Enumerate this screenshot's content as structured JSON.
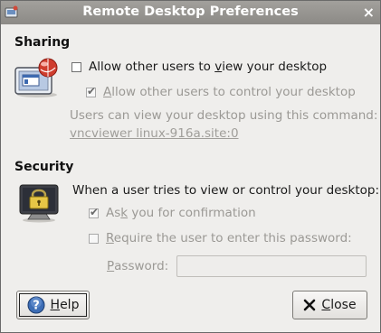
{
  "window": {
    "title": "Remote Desktop Preferences",
    "close_glyph": "×"
  },
  "sharing": {
    "heading": "Sharing",
    "icon": "remote-desktop-share-icon",
    "allow_view": {
      "pre": "Allow other users to ",
      "mnemonic": "v",
      "post": "iew your desktop",
      "checked": false
    },
    "allow_control": {
      "pre": "",
      "mnemonic": "A",
      "post": "llow other users to control your desktop",
      "checked": true,
      "enabled": false
    },
    "command_hint": "Users can view your desktop using this command:",
    "command_link": "vncviewer linux-916a.site:0"
  },
  "security": {
    "heading": "Security",
    "icon": "lock-monitor-icon",
    "prompt": "When a user tries to view or control your desktop:",
    "ask_confirm": {
      "pre": "As",
      "mnemonic": "k",
      "post": " you for confirmation",
      "checked": true,
      "enabled": false
    },
    "require_pw": {
      "pre": "",
      "mnemonic": "R",
      "post": "equire the user to enter this password:",
      "checked": false,
      "enabled": false
    },
    "password_label": {
      "pre": "",
      "mnemonic": "P",
      "post": "assword:"
    },
    "password_value": ""
  },
  "buttons": {
    "help": {
      "pre": "",
      "mnemonic": "H",
      "post": "elp"
    },
    "close": {
      "pre": "",
      "mnemonic": "C",
      "post": "lose"
    }
  },
  "colors": {
    "titlebar": "#96948f",
    "disabled_text": "#9b9995"
  }
}
